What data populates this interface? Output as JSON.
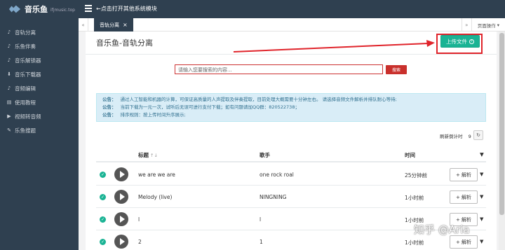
{
  "app": {
    "logo_title": "音乐鱼",
    "logo_subtitle": "ifjmusic.top",
    "header_hint": "←点击打开其他系统模块"
  },
  "sidebar": {
    "items": [
      {
        "label": "音轨分离",
        "icon": "music-note-icon"
      },
      {
        "label": "乐鱼伴奏",
        "icon": "music-note-icon"
      },
      {
        "label": "音乐解锁器",
        "icon": "music-note-icon"
      },
      {
        "label": "音乐下载器",
        "icon": "download-icon"
      },
      {
        "label": "音频编辑",
        "icon": "music-note-icon"
      },
      {
        "label": "使用教程",
        "icon": "book-icon"
      },
      {
        "label": "视频转音频",
        "icon": "video-icon"
      },
      {
        "label": "乐鱼搜题",
        "icon": "pencil-icon"
      }
    ]
  },
  "tabs": {
    "active": "音轨分离",
    "page_ops": "页面操作"
  },
  "main": {
    "title": "音乐鱼-音轨分离",
    "upload_label": "上传文件",
    "search_placeholder": "请输入您要搜索的内容...",
    "search_label": "搜索",
    "notices": [
      {
        "label": "公告：",
        "text": "通过人工智能和机器的计算，可保证高质量的人声提取及伴奏提取，目前处理大概需要十分钟左右。 请选择音频文件解析并排队耐心等待;"
      },
      {
        "label": "公告：",
        "text": "当前下载为一元一次，试听后无误可进行支付下载；如有问题请加QQ群：820522738；"
      },
      {
        "label": "公告：",
        "text": "排序规则：按上传时间升序展示;"
      }
    ],
    "refresh_label": "刷新倒计时",
    "refresh_count": "9"
  },
  "table": {
    "headers": {
      "title": "标题",
      "sort_icon": "↑↓",
      "singer": "歌手",
      "time": "时间"
    },
    "rows": [
      {
        "title": "we are we are",
        "singer": "one rock roal",
        "time": "25分钟前",
        "action": "+ 解析"
      },
      {
        "title": "Melody (live)",
        "singer": "NINGNING",
        "time": "1小时前",
        "action": "+ 解析"
      },
      {
        "title": "l",
        "singer": "l",
        "time": "1小时前",
        "action": "+ 解析"
      },
      {
        "title": "2",
        "singer": "1",
        "time": "1小时前",
        "action": "+ 解析"
      }
    ]
  },
  "watermark": "知乎 @Aria",
  "colors": {
    "sidebar": "#2f4050",
    "accent": "#1ab394",
    "danger": "#c9302c",
    "highlight": "#e0242b"
  }
}
